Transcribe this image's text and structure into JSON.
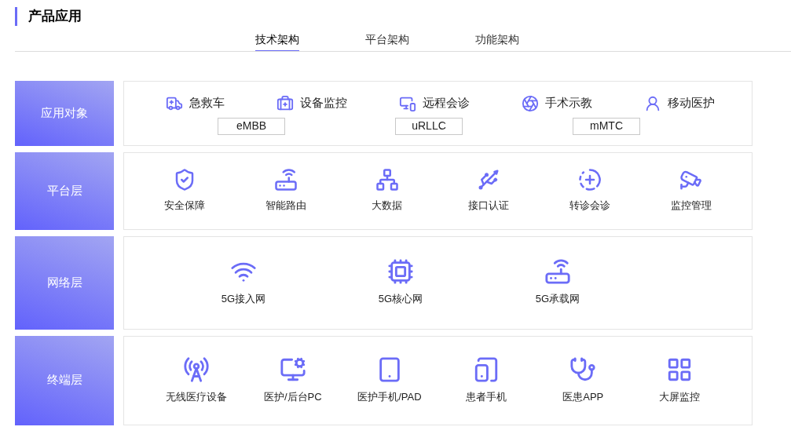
{
  "section_title": "产品应用",
  "tabs": [
    {
      "label": "技术架构",
      "selected": true
    },
    {
      "label": "平台架构",
      "selected": false
    },
    {
      "label": "功能架构",
      "selected": false
    }
  ],
  "layers": [
    {
      "kind": "objects",
      "label": "应用对象",
      "items": [
        "急救车",
        "设备监控",
        "远程会诊",
        "手术示教",
        "移动医护"
      ],
      "tags": [
        "eMBB",
        "uRLLC",
        "mMTC"
      ]
    },
    {
      "kind": "platform",
      "label": "平台层",
      "items": [
        "安全保障",
        "智能路由",
        "大数据",
        "接口认证",
        "转诊会诊",
        "监控管理"
      ]
    },
    {
      "kind": "network",
      "label": "网络层",
      "items": [
        "5G接入网",
        "5G核心网",
        "5G承载网"
      ]
    },
    {
      "kind": "terminal",
      "label": "终端层",
      "items": [
        "无线医疗设备",
        "医护/后台PC",
        "医护手机/PAD",
        "患者手机",
        "医患APP",
        "大屏监控"
      ]
    }
  ]
}
